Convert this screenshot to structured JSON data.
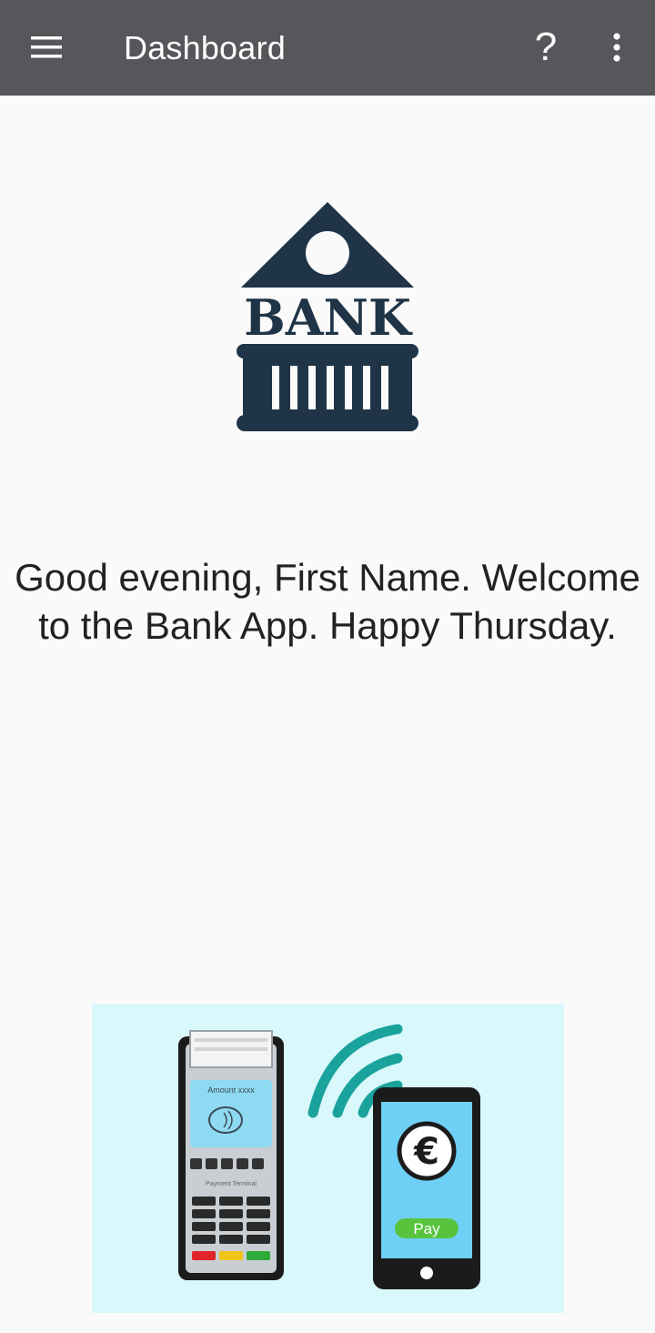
{
  "appbar": {
    "title": "Dashboard",
    "help_glyph": "?",
    "icons": [
      "hamburger-menu-icon",
      "help-icon",
      "more-vert-icon"
    ],
    "background_color": "#56575b"
  },
  "logo": {
    "text": "BANK",
    "color": "#1f3447"
  },
  "greeting": {
    "text": "Good evening, First Name. Welcome to the Bank App. Happy Thursday."
  },
  "illustration": {
    "terminal_screen_text": "Amount xxxx",
    "terminal_label": "Payment Terminal",
    "phone_button_text": "Pay",
    "phone_symbol": "€",
    "background_color": "#d8f8fb"
  }
}
